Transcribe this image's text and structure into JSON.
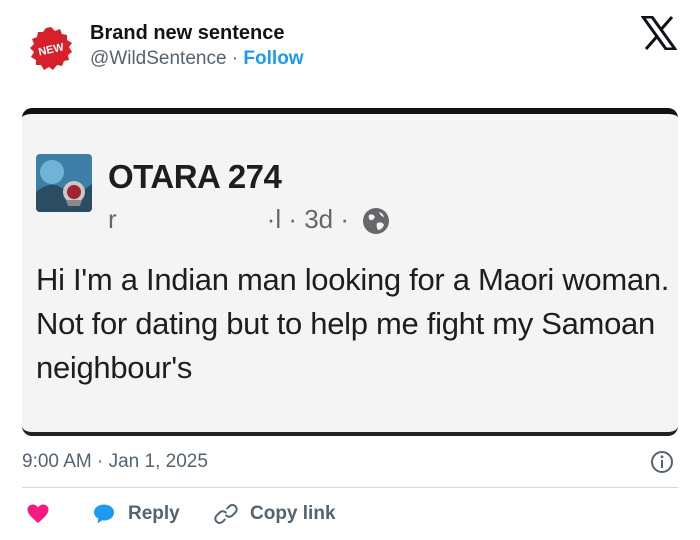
{
  "tweet": {
    "author": {
      "name": "Brand new sentence",
      "handle": "@WildSentence",
      "separator": " · ",
      "follow_label": "Follow",
      "avatar_badge_text": "NEW"
    },
    "platform_icon": "x-logo-icon",
    "timestamp": "9:00 AM · Jan 1, 2025",
    "actions": {
      "like_icon": "heart-icon",
      "reply_icon": "speech-bubble-icon",
      "reply_label": "Reply",
      "copy_icon": "link-icon",
      "copy_label": "Copy link"
    },
    "info_icon": "info-icon"
  },
  "embedded_post": {
    "page_name": "OTARA 274",
    "meta_partial": "r",
    "meta_suffix": "·l · 3d ·",
    "visibility_icon": "globe-icon",
    "text": "Hi I'm a Indian man looking for a Maori woman. Not for dating but to help me fight my Samoan neighbour's"
  },
  "colors": {
    "link_blue": "#1d9bf0",
    "like_pink": "#f91880",
    "secondary_text": "#536471",
    "badge_red": "#d6212a"
  }
}
